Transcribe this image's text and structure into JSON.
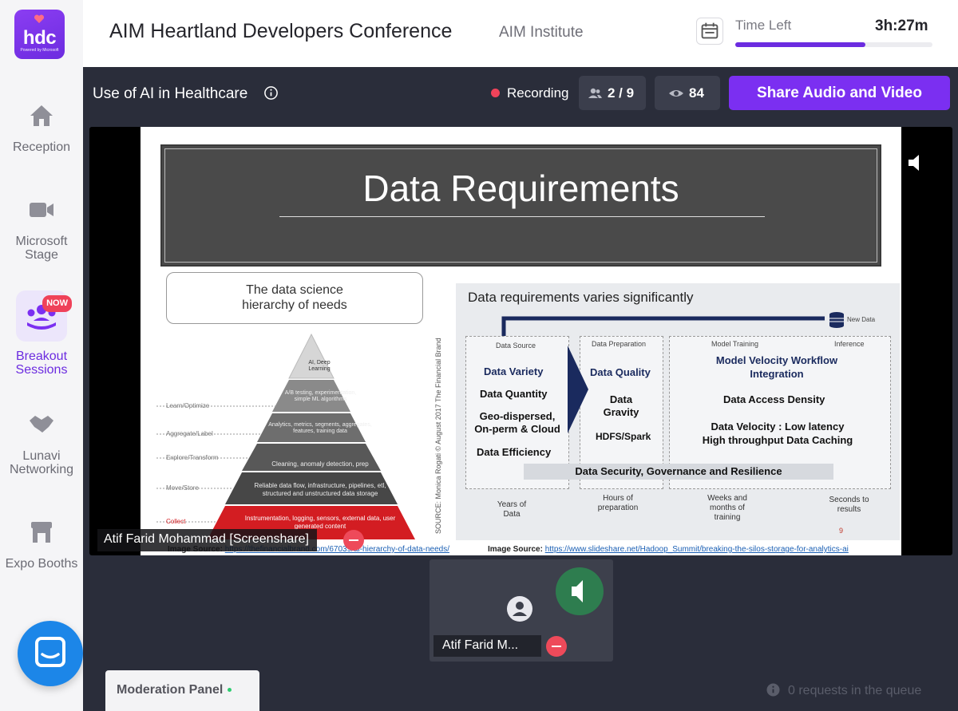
{
  "app": {
    "logo_text": "hdc",
    "logo_subtext": "Powered by Microsoft"
  },
  "sidebar": {
    "items": [
      {
        "label": "Reception",
        "icon": "home-icon"
      },
      {
        "label": "Microsoft Stage",
        "icon": "video-camera-icon"
      },
      {
        "label": "Breakout Sessions",
        "icon": "group-icon",
        "badge": "NOW",
        "active": true
      },
      {
        "label": "Lunavi Networking",
        "icon": "handshake-icon"
      },
      {
        "label": "Expo Booths",
        "icon": "booth-icon"
      }
    ]
  },
  "header": {
    "title": "AIM Heartland Developers Conference",
    "organizer": "AIM Institute",
    "time_left_label": "Time Left",
    "time_left_value": "3h:27m",
    "time_progress": 0.66
  },
  "session": {
    "title": "Use of AI in Healthcare",
    "recording_label": "Recording",
    "participants": "2 / 9",
    "viewers": "84",
    "share_button": "Share Audio and Video"
  },
  "slide": {
    "title": "Data Requirements",
    "callout": [
      "The data science",
      "hierarchy of needs"
    ],
    "pyramid_levels": [
      {
        "label": "AI, Deep Learning",
        "side": ""
      },
      {
        "label": "A/B testing, experimentation, simple ML algorithms",
        "side": "Learn/Optimize"
      },
      {
        "label": "Analytics, metrics, segments, aggregates, features, training data",
        "side": "Aggregate/Label"
      },
      {
        "label": "Cleaning, anomaly detection, prep",
        "side": "Explore/Transform"
      },
      {
        "label": "Reliable data flow, infrastructure, pipelines, etl, structured and unstructured data storage",
        "side": "Move/Store"
      },
      {
        "label": "Instrumentation, logging, sensors, external data, user generated content",
        "side": "Collect"
      }
    ],
    "vertical_source": "SOURCE: Monica Rogati © August 2017 The Financial Brand",
    "left_source_label": "Image Source:",
    "left_source_url": "https://thefinancialbrand.com/67039/ai-hierarchy-of-data-needs/",
    "panel_title": "Data requirements varies significantly",
    "new_data": "New Data",
    "stages": [
      "Data Source",
      "Data Preparation",
      "Model Training",
      "Inference"
    ],
    "source_items": [
      "Data Variety",
      "Data Quantity",
      "Geo-dispersed, On-perm & Cloud",
      "Data Efficiency"
    ],
    "prep_items": [
      "Data Quality",
      "Data Gravity",
      "HDFS/Spark"
    ],
    "training_items": [
      "Model Velocity Workflow Integration",
      "Data Access Density",
      "Data Velocity : Low latency High throughput Data Caching"
    ],
    "security": "Data Security, Governance and Resilience",
    "timeline": [
      "Years of Data",
      "Hours of preparation",
      "Weeks and months of training",
      "Seconds to results"
    ],
    "page_no": "9",
    "right_source_label": "Image Source:",
    "right_source_url": "https://www.slideshare.net/Hadoop_Summit/breaking-the-silos-storage-for-analytics-ai"
  },
  "stage": {
    "presenter_caption": "Atif Farid Mohammad [Screenshare]"
  },
  "tile": {
    "name": "Atif Farid M..."
  },
  "footer": {
    "moderation_panel": "Moderation Panel",
    "queue_text": "0 requests in the queue"
  }
}
